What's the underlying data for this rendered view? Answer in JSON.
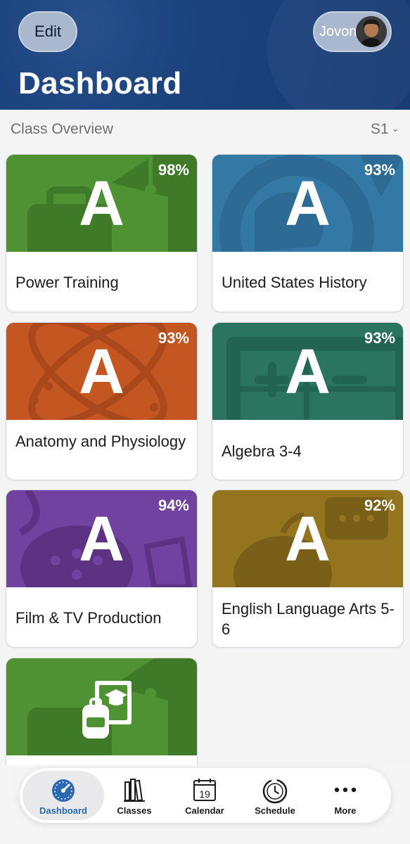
{
  "header": {
    "edit_label": "Edit",
    "user_name": "Jovon",
    "title": "Dashboard",
    "color": "#1b427d"
  },
  "overview": {
    "title": "Class Overview",
    "term": "S1"
  },
  "classes": [
    {
      "name": "Power Training",
      "grade": "A",
      "percent": "98%",
      "color": "#4a8a30",
      "icon": "briefcase-icon"
    },
    {
      "name": "United States History",
      "grade": "A",
      "percent": "93%",
      "color": "#2c6d99",
      "icon": "globe-icon"
    },
    {
      "name": "Anatomy and Physiology",
      "grade": "A",
      "percent": "93%",
      "color": "#c0521e",
      "icon": "atom-icon"
    },
    {
      "name": "Algebra 3-4",
      "grade": "A",
      "percent": "93%",
      "color": "#246a57",
      "icon": "calculator-icon"
    },
    {
      "name": "Film & TV Production",
      "grade": "A",
      "percent": "94%",
      "color": "#6a3a8e",
      "icon": "film-icon"
    },
    {
      "name": "English Language Arts 5-6",
      "grade": "A",
      "percent": "92%",
      "color": "#8a6b1c",
      "icon": "apple-icon"
    },
    {
      "name": "",
      "grade": "",
      "percent": "",
      "color": "#4a8a30",
      "icon": "backpack-book-icon"
    }
  ],
  "tabs": [
    {
      "label": "Dashboard",
      "icon": "speedometer-icon",
      "active": true
    },
    {
      "label": "Classes",
      "icon": "books-icon",
      "active": false
    },
    {
      "label": "Calendar",
      "icon": "calendar-icon",
      "active": false,
      "day": "19"
    },
    {
      "label": "Schedule",
      "icon": "clock-icon",
      "active": false
    },
    {
      "label": "More",
      "icon": "more-dots-icon",
      "active": false
    }
  ],
  "colors": {
    "accent": "#2c68b3",
    "background": "#f4f4f5"
  }
}
